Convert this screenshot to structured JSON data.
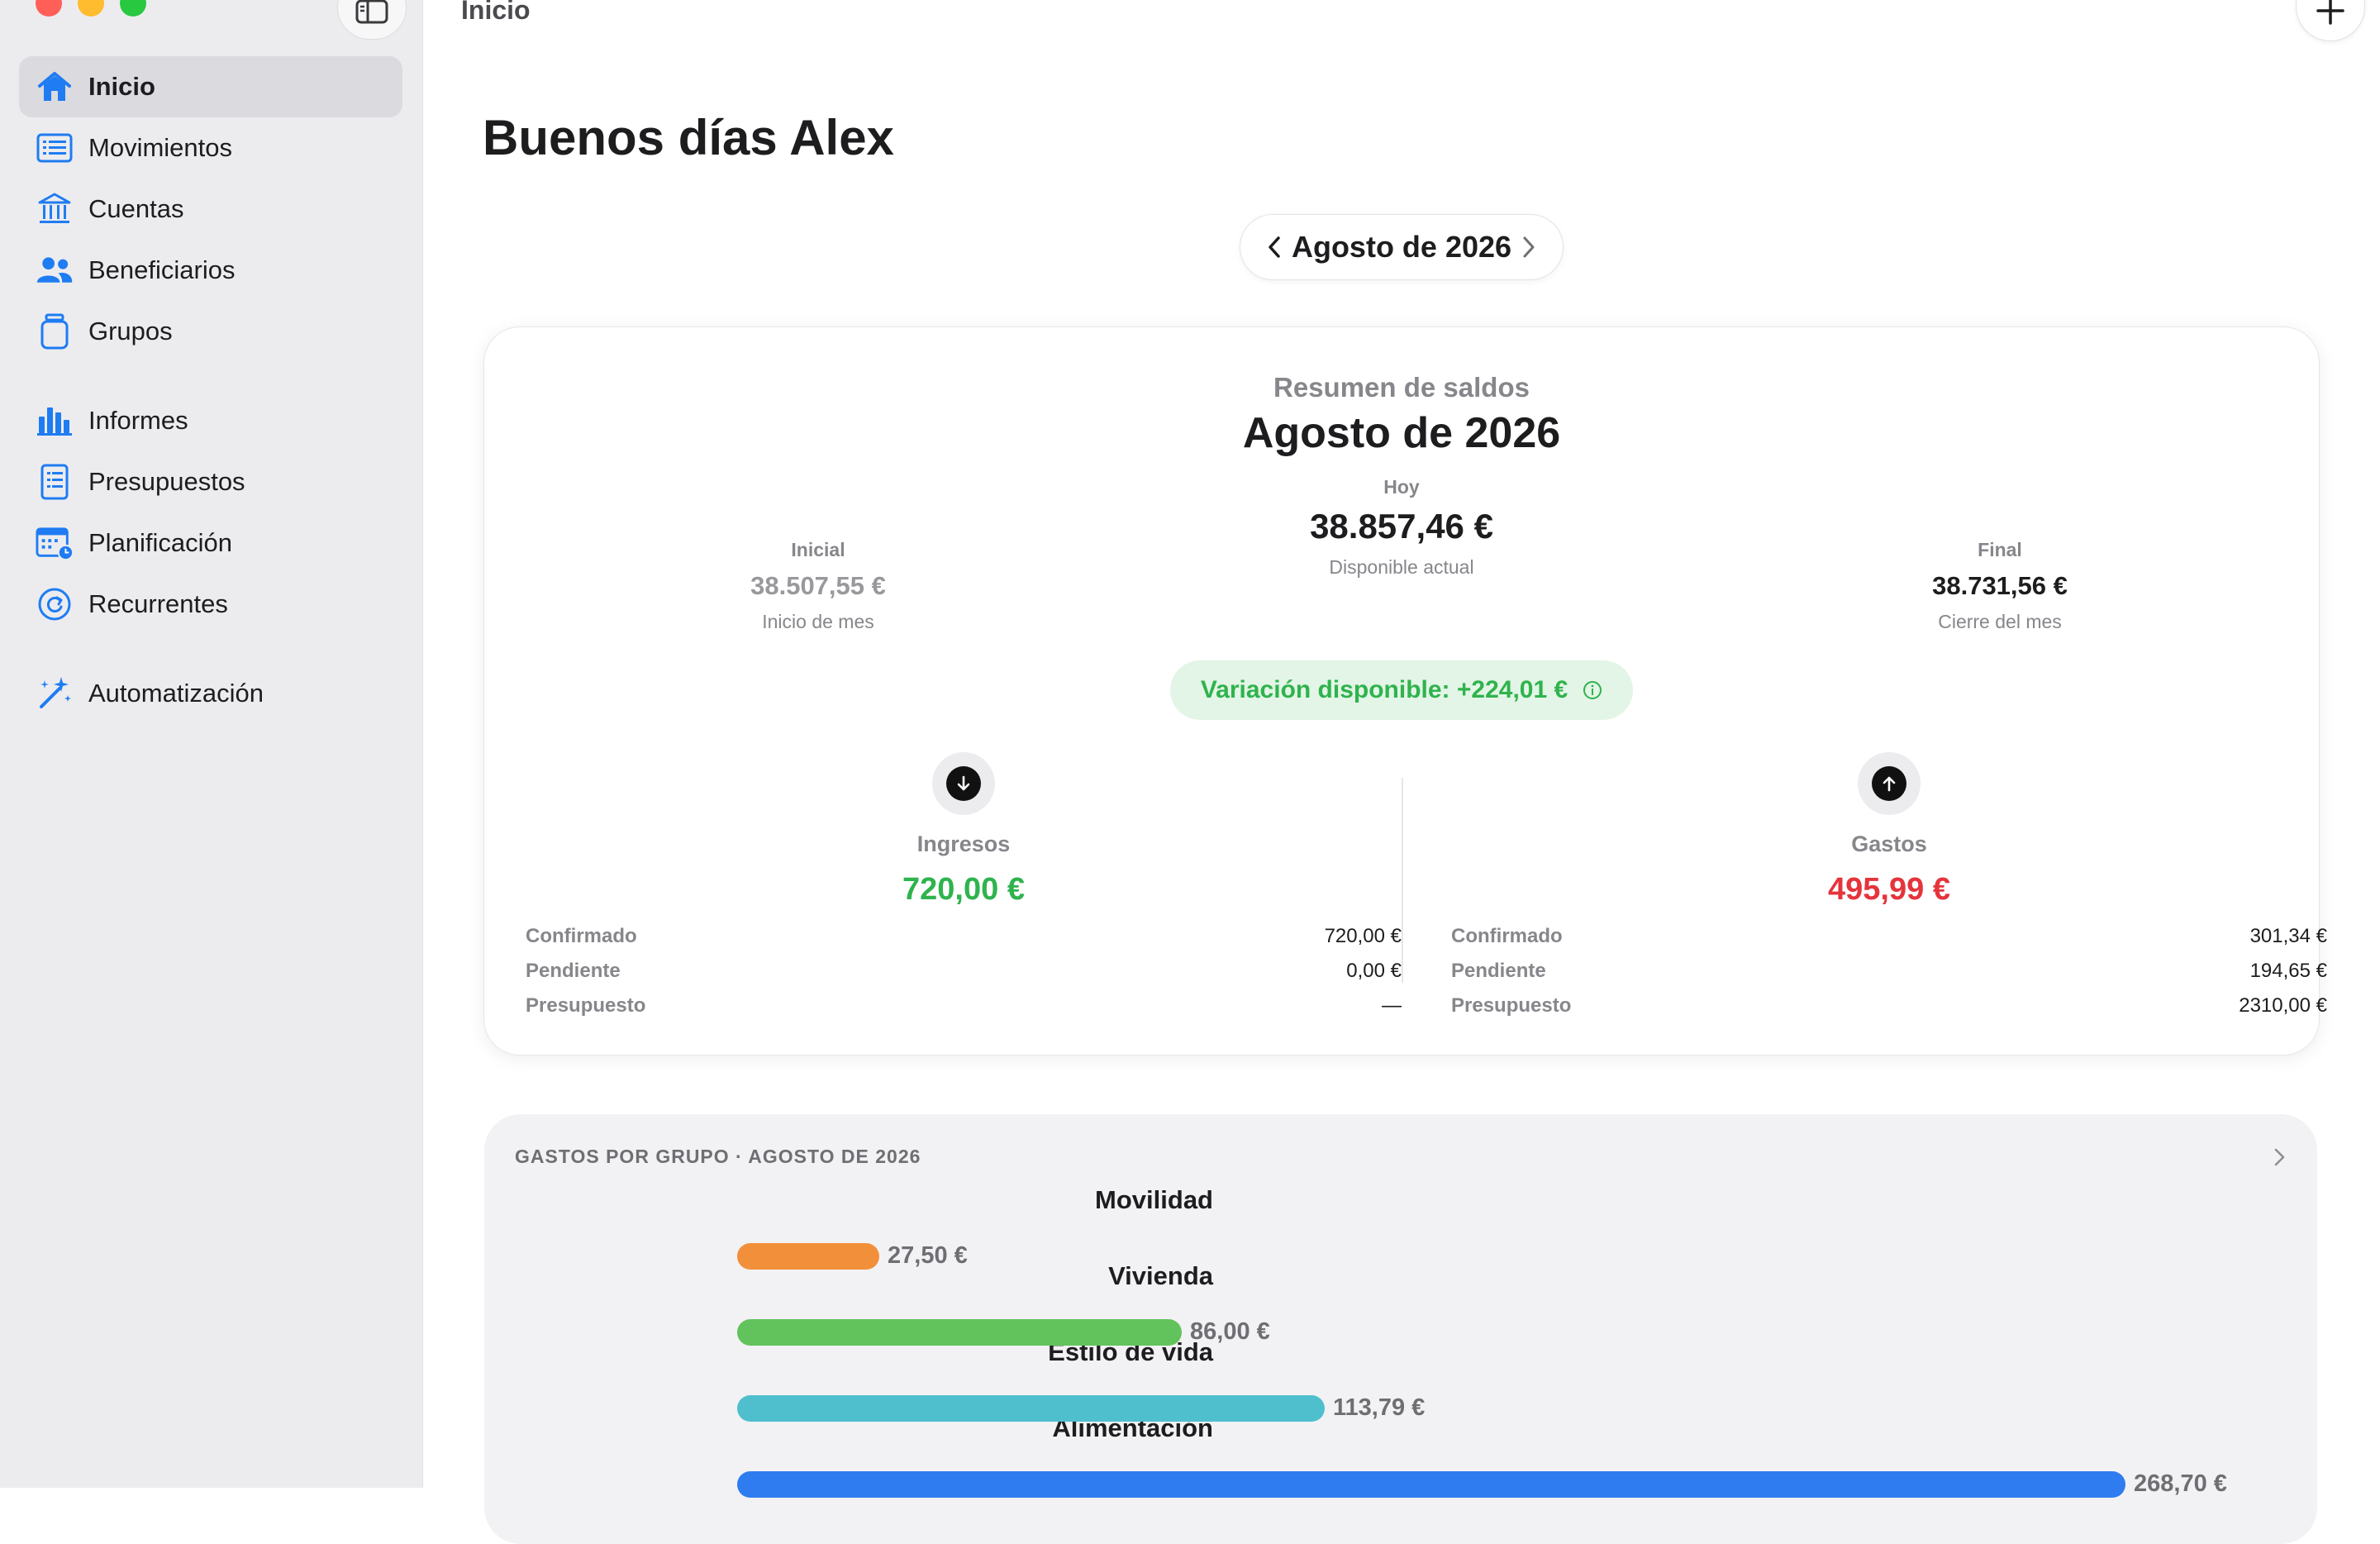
{
  "window": {
    "title": "Inicio"
  },
  "colors": {
    "accent": "#1f7cf2",
    "income": "#2fb34d",
    "expense": "#e5343c"
  },
  "sidebar": {
    "items": [
      {
        "label": "Inicio",
        "icon": "house-icon",
        "active": true
      },
      {
        "label": "Movimientos",
        "icon": "list-icon"
      },
      {
        "label": "Cuentas",
        "icon": "bank-icon"
      },
      {
        "label": "Beneficiarios",
        "icon": "people-icon"
      },
      {
        "label": "Grupos",
        "icon": "jar-icon"
      },
      {
        "label": "Informes",
        "icon": "bar-chart-icon"
      },
      {
        "label": "Presupuestos",
        "icon": "document-icon"
      },
      {
        "label": "Planificación",
        "icon": "calendar-clock-icon"
      },
      {
        "label": "Recurrentes",
        "icon": "recurring-icon"
      },
      {
        "label": "Automatización",
        "icon": "magic-wand-icon"
      }
    ]
  },
  "main": {
    "greeting": "Buenos días Alex",
    "month_picker": {
      "label": "Agosto de 2026"
    },
    "summary": {
      "subtitle": "Resumen de saldos",
      "title": "Agosto de 2026",
      "initial": {
        "label": "Inicial",
        "value": "38.507,55 €",
        "caption": "Inicio de mes"
      },
      "today": {
        "label": "Hoy",
        "value": "38.857,46 €",
        "caption": "Disponible actual"
      },
      "final": {
        "label": "Final",
        "value": "38.731,56 €",
        "caption": "Cierre del mes"
      },
      "variation": "Variación disponible: +224,01 €",
      "income": {
        "label": "Ingresos",
        "value": "720,00 €",
        "rows": [
          {
            "k": "Confirmado",
            "v": "720,00 €"
          },
          {
            "k": "Pendiente",
            "v": "0,00 €"
          },
          {
            "k": "Presupuesto",
            "v": "—"
          }
        ]
      },
      "expenses": {
        "label": "Gastos",
        "value": "495,99 €",
        "rows": [
          {
            "k": "Confirmado",
            "v": "301,34 €"
          },
          {
            "k": "Pendiente",
            "v": "194,65 €"
          },
          {
            "k": "Presupuesto",
            "v": "2310,00 €"
          }
        ]
      }
    },
    "groups": {
      "header": "GASTOS POR GRUPO · AGOSTO DE 2026",
      "items": [
        {
          "name": "Movilidad",
          "amount": "27,50 €",
          "value": 27.5,
          "color": "#f28f3b"
        },
        {
          "name": "Vivienda",
          "amount": "86,00 €",
          "value": 86.0,
          "color": "#62c25c"
        },
        {
          "name": "Estilo de vida",
          "amount": "113,79 €",
          "value": 113.79,
          "color": "#4fbfce"
        },
        {
          "name": "Alimentación",
          "amount": "268,70 €",
          "value": 268.7,
          "color": "#2f7cf0"
        }
      ]
    }
  }
}
